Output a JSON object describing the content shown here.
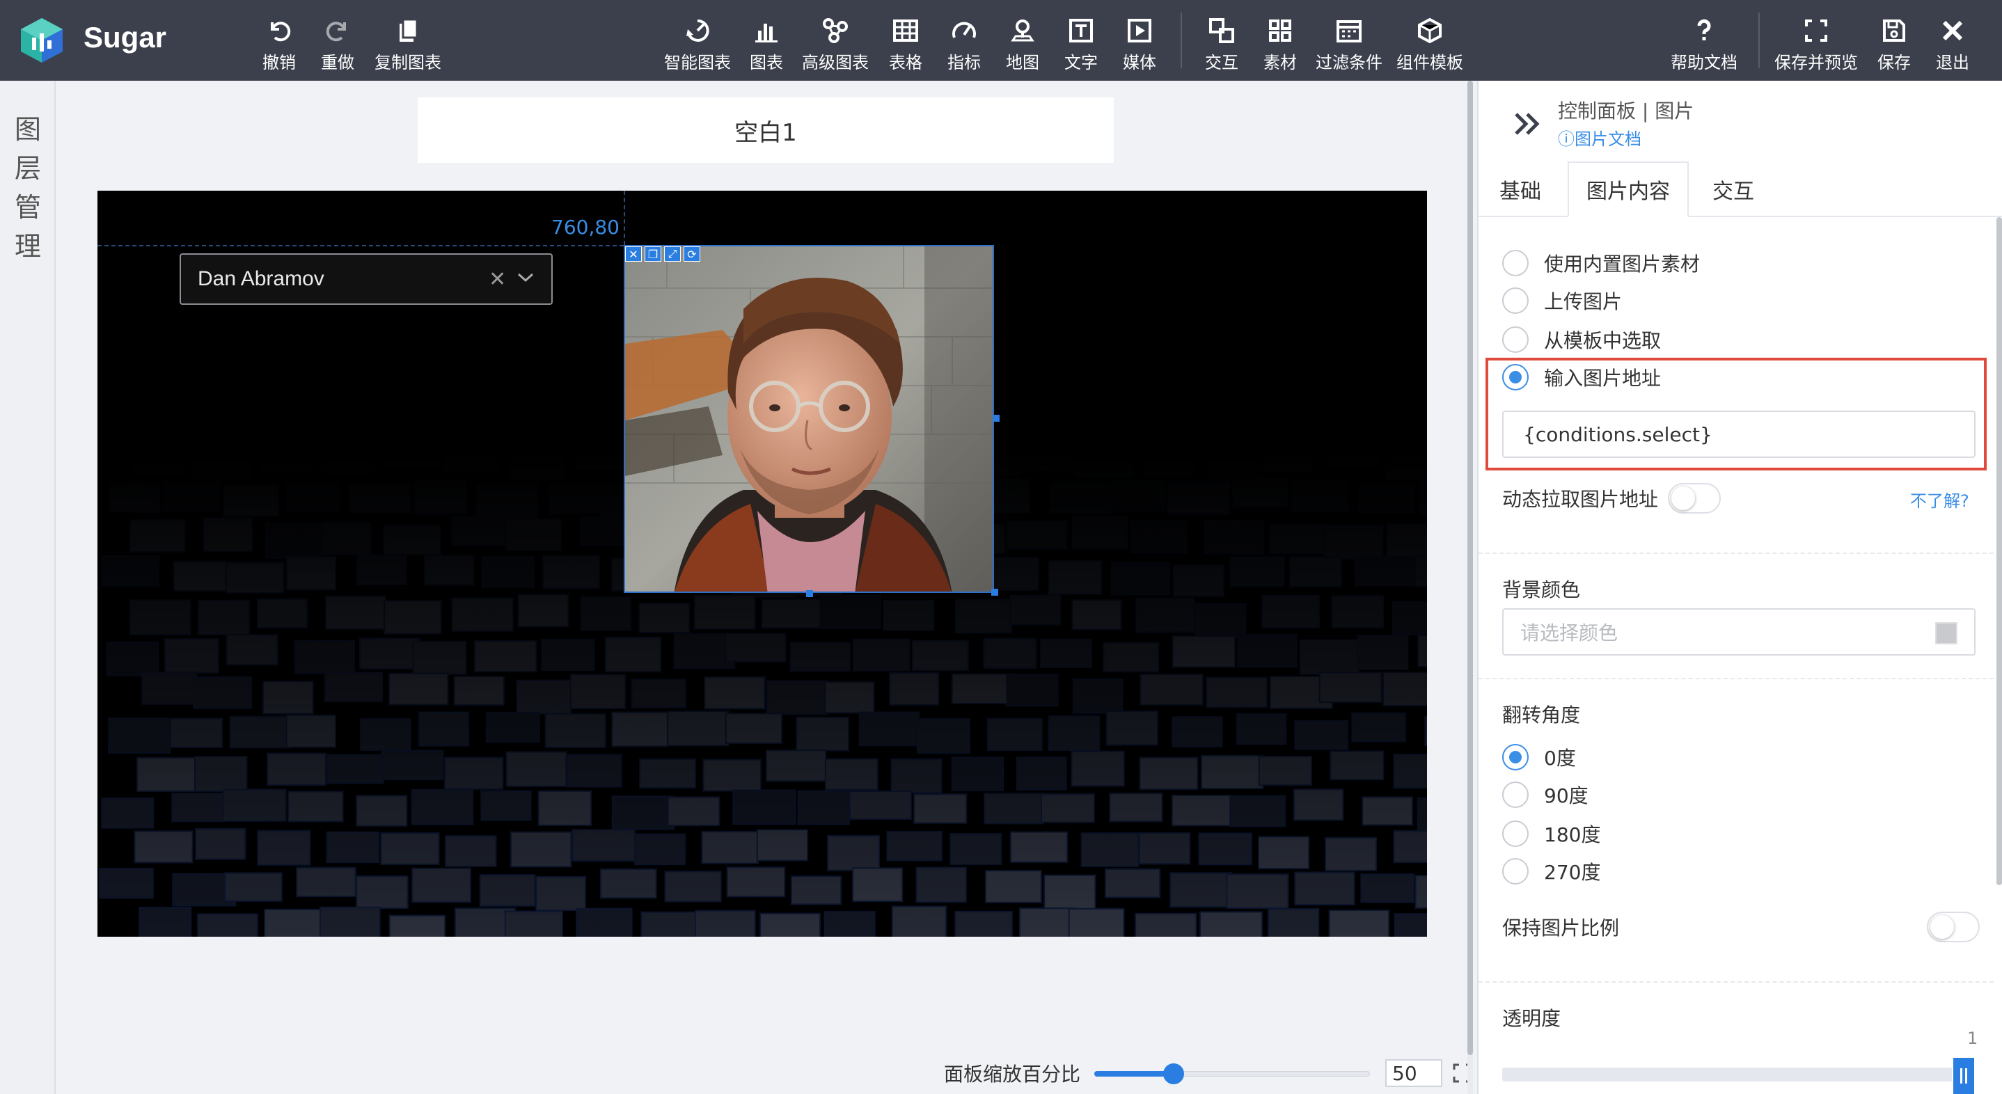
{
  "app": {
    "brand": "Sugar",
    "colors": {
      "toolbar": "#3c404c",
      "accent": "#3a8ee6",
      "highlight": "#e04a3a"
    }
  },
  "toolbar": {
    "undo": "撤销",
    "redo": "重做",
    "copy_chart": "复制图表",
    "smart_chart": "智能图表",
    "chart": "图表",
    "advanced_chart": "高级图表",
    "table": "表格",
    "metric": "指标",
    "map": "地图",
    "text": "文字",
    "media": "媒体",
    "interaction": "交互",
    "material": "素材",
    "filter": "过滤条件",
    "component_template": "组件模板",
    "help_doc": "帮助文档",
    "save_preview": "保存并预览",
    "save": "保存",
    "exit": "退出"
  },
  "layer_panel": {
    "label": "图层管理"
  },
  "canvas": {
    "title": "空白1",
    "coordinates": "760,80",
    "select": {
      "value": "Dan Abramov"
    }
  },
  "zoom": {
    "label": "面板缩放百分比",
    "value": "50",
    "percent": 50
  },
  "panel": {
    "title": "控制面板 | 图片",
    "doc_link": "图片文档",
    "tabs": [
      "基础",
      "图片内容",
      "交互"
    ],
    "active_tab": "图片内容",
    "source": {
      "options": [
        "使用内置图片素材",
        "上传图片",
        "从模板中选取",
        "输入图片地址"
      ],
      "selected": "输入图片地址",
      "url_value": "{conditions.select}"
    },
    "dynamic_fetch": {
      "label": "动态拉取图片地址",
      "help": "不了解?",
      "on": false
    },
    "background": {
      "label": "背景颜色",
      "placeholder": "请选择颜色"
    },
    "rotation": {
      "label": "翻转角度",
      "options": [
        "0度",
        "90度",
        "180度",
        "270度"
      ],
      "selected": "0度"
    },
    "keep_ratio": {
      "label": "保持图片比例",
      "on": false
    },
    "opacity": {
      "label": "透明度",
      "max_label": "1",
      "value": 1
    }
  }
}
